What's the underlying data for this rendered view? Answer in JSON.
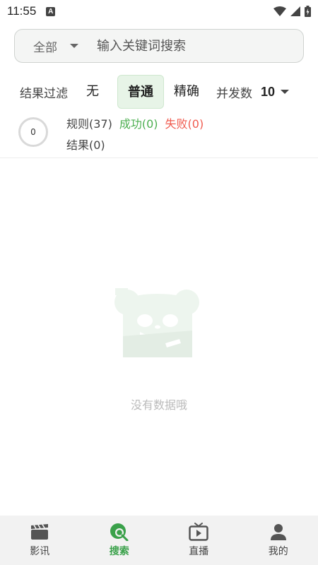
{
  "status_bar": {
    "time": "11:55",
    "notification_glyph": "A"
  },
  "search": {
    "scope": "全部",
    "placeholder": "输入关键词搜索",
    "value": ""
  },
  "filter": {
    "label": "结果过滤",
    "options": [
      "无",
      "普通",
      "精确"
    ],
    "selected": "普通",
    "concurrency_label": "并发数",
    "concurrency_value": "10"
  },
  "stats": {
    "progress": "0",
    "rules": "规则(37)",
    "success": "成功(0)",
    "fail": "失败(0)",
    "results": "结果(0)"
  },
  "empty": {
    "message": "没有数据哦"
  },
  "nav": {
    "items": [
      {
        "label": "影讯",
        "icon": "clapperboard-icon"
      },
      {
        "label": "搜索",
        "icon": "search-icon"
      },
      {
        "label": "直播",
        "icon": "tv-icon"
      },
      {
        "label": "我的",
        "icon": "person-icon"
      }
    ],
    "active": "搜索"
  },
  "colors": {
    "accent": "#3aa14a",
    "success": "#4caf50",
    "fail": "#f05b4f",
    "active_chip": "#e7f4e7"
  }
}
